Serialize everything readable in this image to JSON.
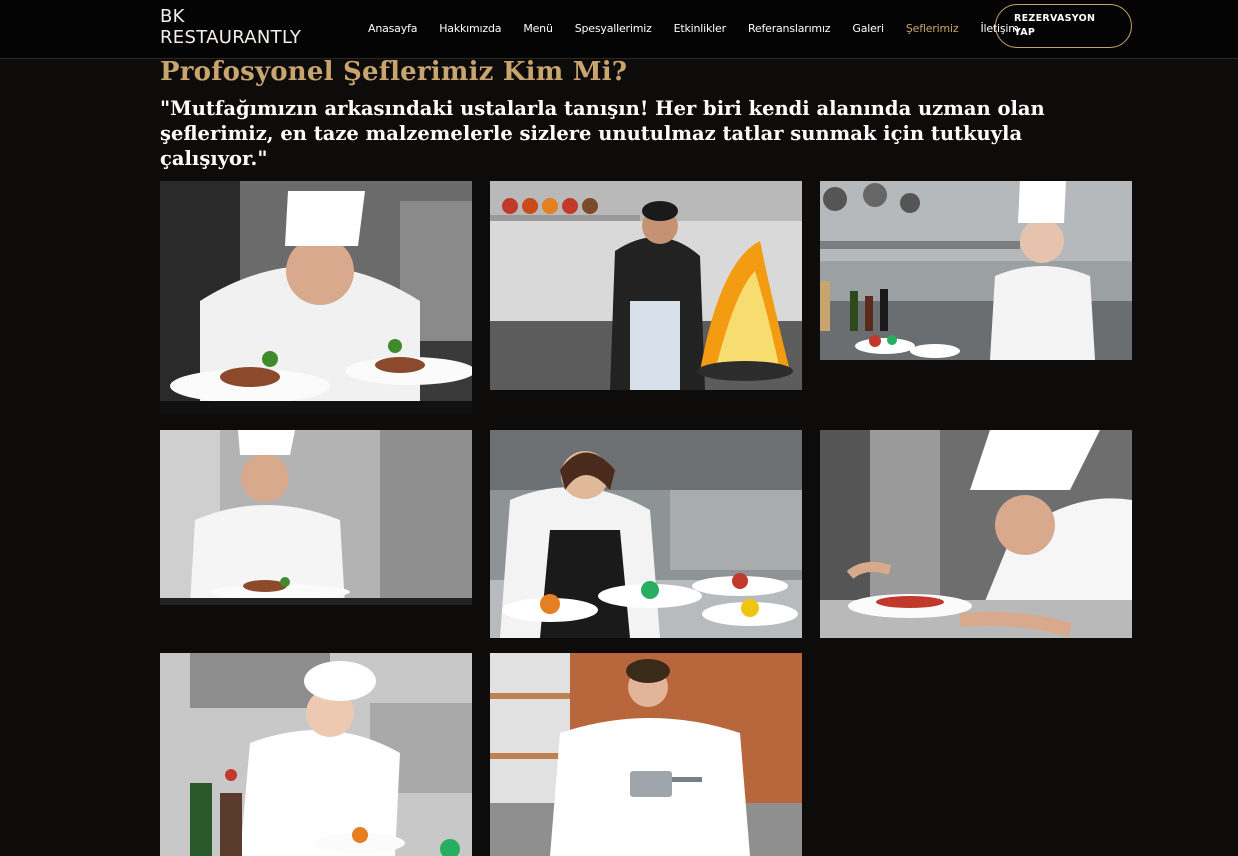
{
  "brand": {
    "name": "BK RESTAURANTLY"
  },
  "nav": {
    "items": [
      {
        "label": "Anasayfa",
        "active": false
      },
      {
        "label": "Hakkımızda",
        "active": false
      },
      {
        "label": "Menü",
        "active": false
      },
      {
        "label": "Spesyallerimiz",
        "active": false
      },
      {
        "label": "Etkinlikler",
        "active": false
      },
      {
        "label": "Referanslarımız",
        "active": false
      },
      {
        "label": "Galeri",
        "active": false
      },
      {
        "label": "Şeflerimiz",
        "active": true
      },
      {
        "label": "İletişim",
        "active": false
      }
    ],
    "reserve_label": "REZERVASYON YAP"
  },
  "chefs_section": {
    "title": "Profosyonel Şeflerimiz Kim Mi?",
    "lead": "\"Mutfağımızın arkasındaki ustalarla tanışın! Her biri kendi alanında uzman olan şeflerimiz, en taze malzemelerle sizlere unutulmaz tatlar sunmak için tutkuyla çalışıyor.\""
  },
  "colors": {
    "accent": "#c8a46e",
    "background": "#0e0c0b",
    "navbar": "#050404",
    "text": "#ffffff"
  },
  "gallery": {
    "photos": [
      {
        "icon": "chef-plating-photo"
      },
      {
        "icon": "chef-flambe-photo"
      },
      {
        "icon": "female-chef-arms-crossed-photo"
      },
      {
        "icon": "smiling-chef-photo"
      },
      {
        "icon": "female-chef-garnishing-photo"
      },
      {
        "icon": "chef-focused-plating-photo"
      },
      {
        "icon": "female-chef-smiling-photo"
      },
      {
        "icon": "female-chef-with-pot-photo"
      }
    ]
  }
}
